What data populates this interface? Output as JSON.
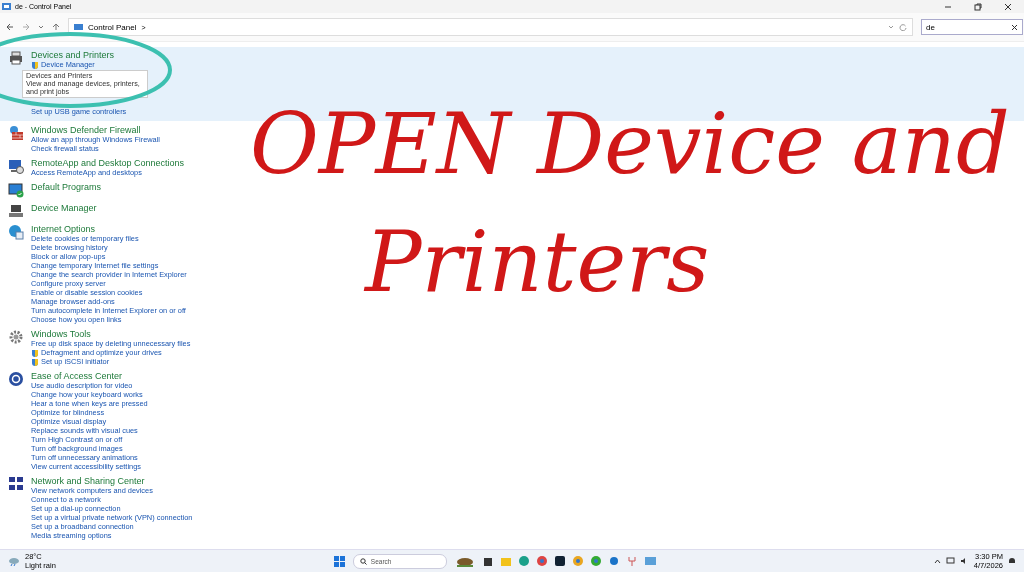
{
  "window": {
    "title": "de - Control Panel"
  },
  "address_bar": {
    "breadcrumb": "Control Panel",
    "separator": ">",
    "search_value": "de"
  },
  "groups": [
    {
      "title": "Devices and Printers",
      "highlighted": true,
      "links": [
        {
          "text": "Device Manager",
          "kind": "shield"
        },
        {
          "text": "Set up USB game controllers",
          "kind": "plain"
        }
      ],
      "tooltip": {
        "title": "Devices and Printers",
        "text": "View and manage devices, printers, and print jobs"
      }
    },
    {
      "title": "Windows Defender Firewall",
      "highlighted": false,
      "links": [
        {
          "text": "Allow an app through Windows Firewall",
          "kind": "plain"
        },
        {
          "text": "Check firewall status",
          "kind": "plain"
        }
      ]
    },
    {
      "title": "RemoteApp and Desktop Connections",
      "highlighted": false,
      "links": [
        {
          "text": "Access RemoteApp and desktops",
          "kind": "plain"
        }
      ]
    },
    {
      "title": "Default Programs",
      "highlighted": false
    },
    {
      "title": "Device Manager",
      "highlighted": false
    },
    {
      "title": "Internet Options",
      "highlighted": false,
      "links": [
        {
          "text": "Delete cookies or temporary files",
          "kind": "plain"
        },
        {
          "text": "Delete browsing history",
          "kind": "plain"
        },
        {
          "text": "Block or allow pop-ups",
          "kind": "plain"
        },
        {
          "text": "Change temporary Internet file settings",
          "kind": "plain"
        },
        {
          "text": "Change the search provider in Internet Explorer",
          "kind": "plain"
        },
        {
          "text": "Configure proxy server",
          "kind": "plain"
        },
        {
          "text": "Enable or disable session cookies",
          "kind": "plain"
        },
        {
          "text": "Manage browser add-ons",
          "kind": "plain"
        },
        {
          "text": "Turn autocomplete in Internet Explorer on or off",
          "kind": "plain"
        },
        {
          "text": "Choose how you open links",
          "kind": "plain"
        }
      ]
    },
    {
      "title": "Windows Tools",
      "highlighted": false,
      "links": [
        {
          "text": "Free up disk space by deleting unnecessary files",
          "kind": "plain"
        },
        {
          "text": "Defragment and optimize your drives",
          "kind": "shield"
        },
        {
          "text": "Set up iSCSI initiator",
          "kind": "shield"
        }
      ]
    },
    {
      "title": "Ease of Access Center",
      "highlighted": false,
      "links": [
        {
          "text": "Use audio description for video",
          "kind": "plain"
        },
        {
          "text": "Change how your keyboard works",
          "kind": "plain"
        },
        {
          "text": "Hear a tone when keys are pressed",
          "kind": "plain"
        },
        {
          "text": "Optimize for blindness",
          "kind": "plain"
        },
        {
          "text": "Optimize visual display",
          "kind": "plain"
        },
        {
          "text": "Replace sounds with visual cues",
          "kind": "plain"
        },
        {
          "text": "Turn High Contrast on or off",
          "kind": "plain"
        },
        {
          "text": "Turn off background images",
          "kind": "plain"
        },
        {
          "text": "Turn off unnecessary animations",
          "kind": "plain"
        },
        {
          "text": "View current accessibility settings",
          "kind": "plain"
        }
      ]
    },
    {
      "title": "Network and Sharing Center",
      "highlighted": false,
      "links": [
        {
          "text": "View network computers and devices",
          "kind": "plain"
        },
        {
          "text": "Connect to a network",
          "kind": "plain"
        },
        {
          "text": "Set up a dial-up connection",
          "kind": "plain"
        },
        {
          "text": "Set up a virtual private network (VPN) connection",
          "kind": "plain"
        },
        {
          "text": "Set up a broadband connection",
          "kind": "plain"
        },
        {
          "text": "Media streaming options",
          "kind": "plain"
        }
      ]
    }
  ],
  "annotation": {
    "lines": [
      "OPEN Device and",
      "Printers"
    ]
  },
  "taskbar": {
    "temperature": "28°C",
    "weather": "Light rain",
    "search_placeholder": "Search",
    "time": "3:30 PM",
    "date": "4/7/2026"
  }
}
